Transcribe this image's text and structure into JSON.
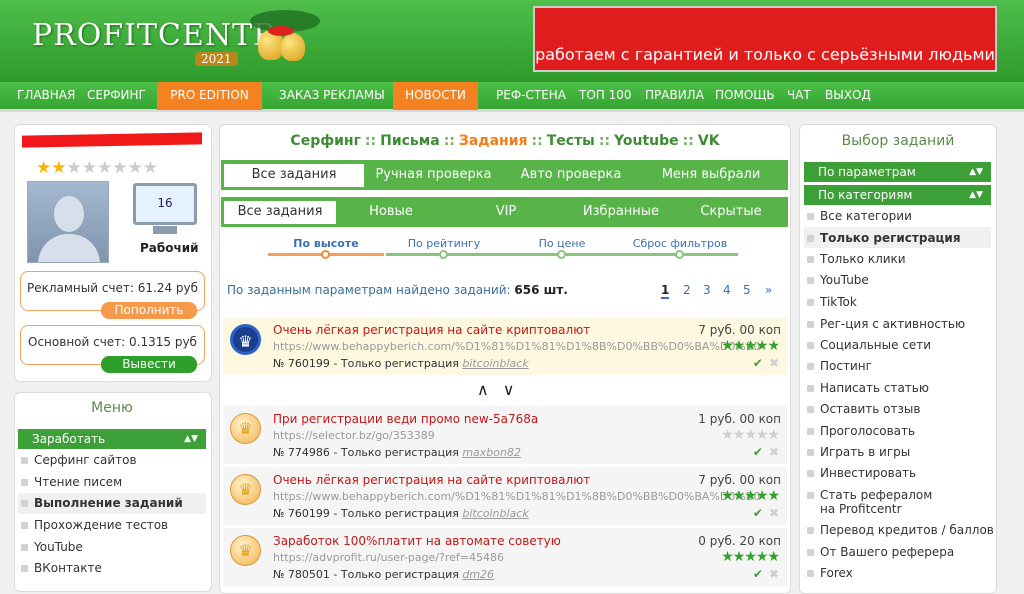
{
  "header": {
    "logo_text": "PROFITCENTR",
    "logo_year": "2021",
    "banner_text": "работаем с гарантией и только с серьёзными людьми"
  },
  "nav": [
    "ГЛАВНАЯ",
    "СЕРФИНГ",
    "PRO EDITION",
    "ЗАКАЗ РЕКЛАМЫ",
    "НОВОСТИ",
    "РЕФ-СТЕНА",
    "ТОП 100",
    "ПРАВИЛА",
    "ПОМОЩЬ",
    "ЧАТ",
    "ВЫХОД"
  ],
  "profile": {
    "rating_stars": 2,
    "rating_max": 10,
    "level_number": "16",
    "status": "Рабочий",
    "ad_account": "Рекламный счет: 61.24 руб",
    "topup_label": "Пополнить",
    "main_account": "Основной счет: 0.1315 руб",
    "withdraw_label": "Вывести"
  },
  "left_menu": {
    "title": "Меню",
    "section": "Заработать",
    "items": [
      "Серфинг сайтов",
      "Чтение писем",
      "Выполнение заданий",
      "Прохождение тестов",
      "YouTube",
      "ВКонтакте"
    ]
  },
  "section_links": [
    "Серфинг",
    "Письма",
    "Задания",
    "Тесты",
    "Youtube",
    "VK"
  ],
  "section_sep": "::",
  "tabs1": [
    "Все задания",
    "Ручная проверка",
    "Авто проверка",
    "Меня выбрали"
  ],
  "tabs2": [
    "Все задания",
    "Новые",
    "VIP",
    "Избранные",
    "Скрытые"
  ],
  "sort": [
    "По высоте",
    "По рейтингу",
    "По цене",
    "Сброс фильтров"
  ],
  "found_text": "По заданным параметрам найдено заданий:",
  "found_count": "656 шт.",
  "pagination": [
    "1",
    "2",
    "3",
    "4",
    "5",
    "»"
  ],
  "tasks": [
    {
      "title": "Очень лёгкая регистрация на сайте криптовалют",
      "url": "https://www.behappyberich.com/%D1%81%D1%81%D1%8B%D0%BB%D0%BA%D0%B0",
      "id": "№ 760199 - Только регистрация",
      "user": "bitcoinblack",
      "price": "7 руб. 00 коп",
      "stars": 5
    },
    {
      "title": "При регистрации веди промо new-5a768a",
      "url": "https://selector.bz/go/353389",
      "id": "№ 774986 - Только регистрация",
      "user": "maxbon82",
      "price": "1 руб. 00 коп",
      "stars": 0
    },
    {
      "title": "Очень лёгкая регистрация на сайте криптовалют",
      "url": "https://www.behappyberich.com/%D1%81%D1%81%D1%8B%D0%BB%D0%BA%D0%B0",
      "id": "№ 760199 - Только регистрация",
      "user": "bitcoinblack",
      "price": "7 руб. 00 коп",
      "stars": 5
    },
    {
      "title": "Заработок 100%платит на автомате советую",
      "url": "https://advprofit.ru/user-page/?ref=45486",
      "id": "№ 780501 - Только регистрация",
      "user": "dm26",
      "price": "0 руб. 20 коп",
      "stars": 5
    }
  ],
  "right_panel": {
    "title": "Выбор заданий",
    "by_params": "По параметрам",
    "by_category": "По категориям",
    "categories": [
      "Все категории",
      "Только регистрация",
      "Только клики",
      "YouTube",
      "TikTok",
      "Рег-ция с активностью",
      "Социальные сети",
      "Постинг",
      "Написать статью",
      "Оставить отзыв",
      "Проголосовать",
      "Играть в игры",
      "Инвестировать",
      "Стать рефералом на Profitcentr",
      "Перевод кредитов / баллов",
      "От Вашего реферера",
      "Forex"
    ]
  },
  "colors": {
    "green": "#3d9f37",
    "orange": "#f58220",
    "red_banner": "#e01d1d",
    "link": "#3a6fb5"
  }
}
